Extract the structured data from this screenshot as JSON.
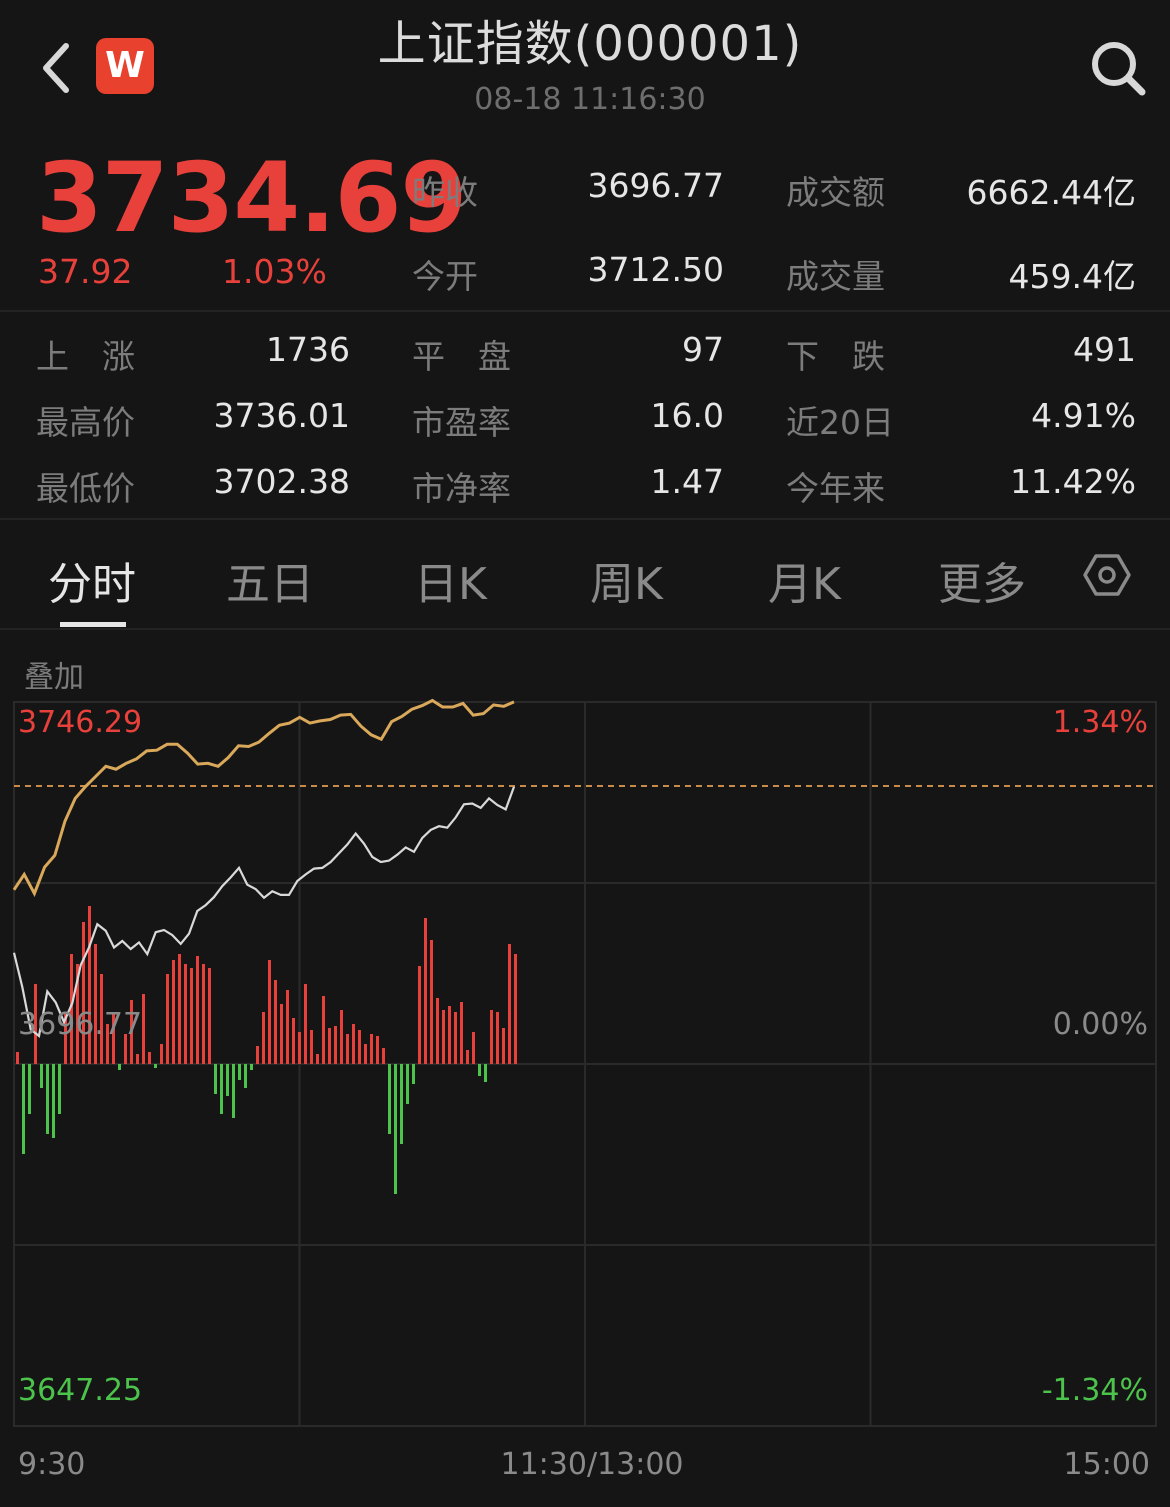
{
  "header": {
    "title": "上证指数(000001)",
    "datetime": "08-18 11:16:30",
    "logo_letter": "W"
  },
  "quote": {
    "price": "3734.69",
    "change": "37.92",
    "change_pct": "1.03%",
    "stats_top": [
      {
        "label": "昨收",
        "value": "3696.77"
      },
      {
        "label": "成交额",
        "value": "6662.44亿"
      },
      {
        "label": "今开",
        "value": "3712.50"
      },
      {
        "label": "成交量",
        "value": "459.4亿"
      }
    ],
    "stats_grid": [
      [
        {
          "label": "上　涨",
          "value": "1736"
        },
        {
          "label": "平　盘",
          "value": "97"
        },
        {
          "label": "下　跌",
          "value": "491"
        }
      ],
      [
        {
          "label": "最高价",
          "value": "3736.01"
        },
        {
          "label": "市盈率",
          "value": "16.0"
        },
        {
          "label": "近20日",
          "value": "4.91%"
        }
      ],
      [
        {
          "label": "最低价",
          "value": "3702.38"
        },
        {
          "label": "市净率",
          "value": "1.47"
        },
        {
          "label": "今年来",
          "value": "11.42%"
        }
      ]
    ]
  },
  "tabs": [
    {
      "label": "分时",
      "active": true
    },
    {
      "label": "五日",
      "active": false
    },
    {
      "label": "日K",
      "active": false
    },
    {
      "label": "周K",
      "active": false
    },
    {
      "label": "月K",
      "active": false
    },
    {
      "label": "更多",
      "active": false
    }
  ],
  "overlay_label": "叠加",
  "colors": {
    "up": "#e8413b",
    "down": "#4cc44c",
    "price_line": "#d9d9d9",
    "avg_line": "#d9a85a",
    "ref_line": "#c98a4a",
    "grid": "#2a2a2a"
  },
  "chart_data": {
    "type": "line",
    "y_top_label": "3746.29",
    "y_mid_label": "3696.77",
    "y_bottom_label": "3647.25",
    "pct_top_label": "1.34%",
    "pct_mid_label": "0.00%",
    "pct_bottom_label": "-1.34%",
    "x_labels": [
      "9:30",
      "11:30/13:00",
      "15:00"
    ],
    "ylim": [
      3647.25,
      3746.29
    ],
    "prev_close": 3696.77,
    "price_series": [
      3712.0,
      3707.3,
      3701.5,
      3700.6,
      3706.7,
      3705.2,
      3702.5,
      3705.1,
      3710.3,
      3712.7,
      3715.9,
      3715.0,
      3712.7,
      3713.6,
      3712.5,
      3713.4,
      3711.8,
      3714.8,
      3715.1,
      3714.4,
      3713.2,
      3714.6,
      3717.7,
      3718.5,
      3719.6,
      3721.1,
      3722.3,
      3723.6,
      3721.3,
      3720.7,
      3719.5,
      3720.4,
      3719.9,
      3719.9,
      3721.8,
      3722.7,
      3723.5,
      3723.6,
      3724.4,
      3725.6,
      3726.8,
      3728.3,
      3726.9,
      3725.1,
      3724.4,
      3724.6,
      3725.4,
      3726.4,
      3725.8,
      3727.7,
      3728.8,
      3729.3,
      3729.1,
      3730.5,
      3732.3,
      3732.4,
      3731.8,
      3733.1,
      3732.2,
      3731.6,
      3734.7
    ],
    "avg_series": [
      3720.6,
      3722.7,
      3720.1,
      3723.7,
      3725.3,
      3730.0,
      3733.1,
      3734.7,
      3736.1,
      3737.5,
      3737.1,
      3737.9,
      3738.5,
      3739.6,
      3739.7,
      3740.5,
      3740.5,
      3739.3,
      3737.8,
      3737.9,
      3737.5,
      3738.7,
      3740.3,
      3740.2,
      3740.8,
      3742.0,
      3743.1,
      3743.4,
      3744.2,
      3743.4,
      3743.7,
      3743.9,
      3744.5,
      3744.6,
      3743.0,
      3741.8,
      3741.2,
      3743.6,
      3744.3,
      3745.3,
      3745.8,
      3746.5,
      3745.6,
      3745.6,
      3746.1,
      3744.5,
      3744.7,
      3745.9,
      3745.7,
      3746.3
    ],
    "volume_delta": [
      6,
      -45,
      -25,
      40,
      -12,
      -35,
      -37,
      -25,
      25,
      55,
      50,
      71,
      79,
      60,
      45,
      20,
      25,
      -3,
      15,
      32,
      5,
      35,
      6,
      -2,
      10,
      45,
      52,
      55,
      50,
      48,
      54,
      50,
      48,
      -15,
      -25,
      -16,
      -27,
      -8,
      -12,
      -3,
      9,
      26,
      52,
      42,
      30,
      37,
      23,
      16,
      40,
      17,
      5,
      34,
      18,
      19,
      27,
      15,
      20,
      17,
      10,
      15,
      14,
      8,
      -35,
      -65,
      -40,
      -20,
      -10,
      49,
      73,
      62,
      33,
      27,
      29,
      26,
      31,
      7,
      16,
      -6,
      -9,
      27,
      26,
      18,
      60,
      55
    ]
  }
}
